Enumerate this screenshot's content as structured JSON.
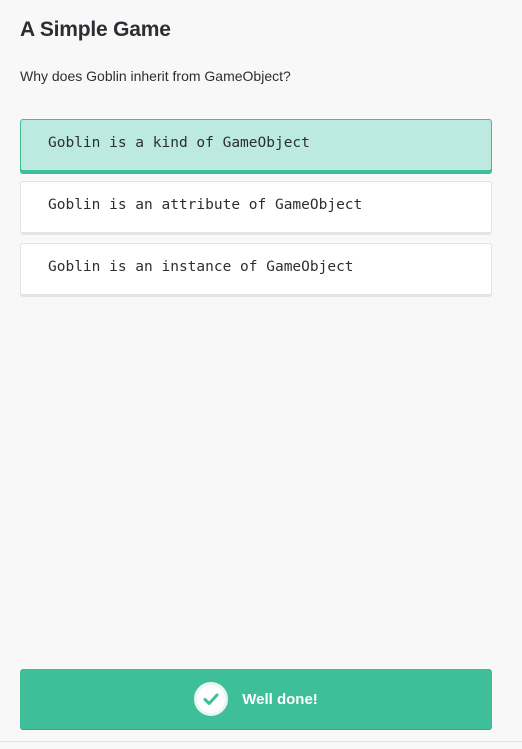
{
  "page": {
    "title": "A Simple Game",
    "question": "Why does Goblin inherit from GameObject?"
  },
  "options": [
    {
      "label": "Goblin is a kind of GameObject",
      "selected": true
    },
    {
      "label": "Goblin is an attribute of GameObject",
      "selected": false
    },
    {
      "label": "Goblin is an instance of GameObject",
      "selected": false
    }
  ],
  "feedback": {
    "icon": "check-icon",
    "message": "Well done!"
  },
  "colors": {
    "accent": "#3ebf99",
    "selected_bg": "#bce9e0",
    "background": "#f8f8f8"
  }
}
